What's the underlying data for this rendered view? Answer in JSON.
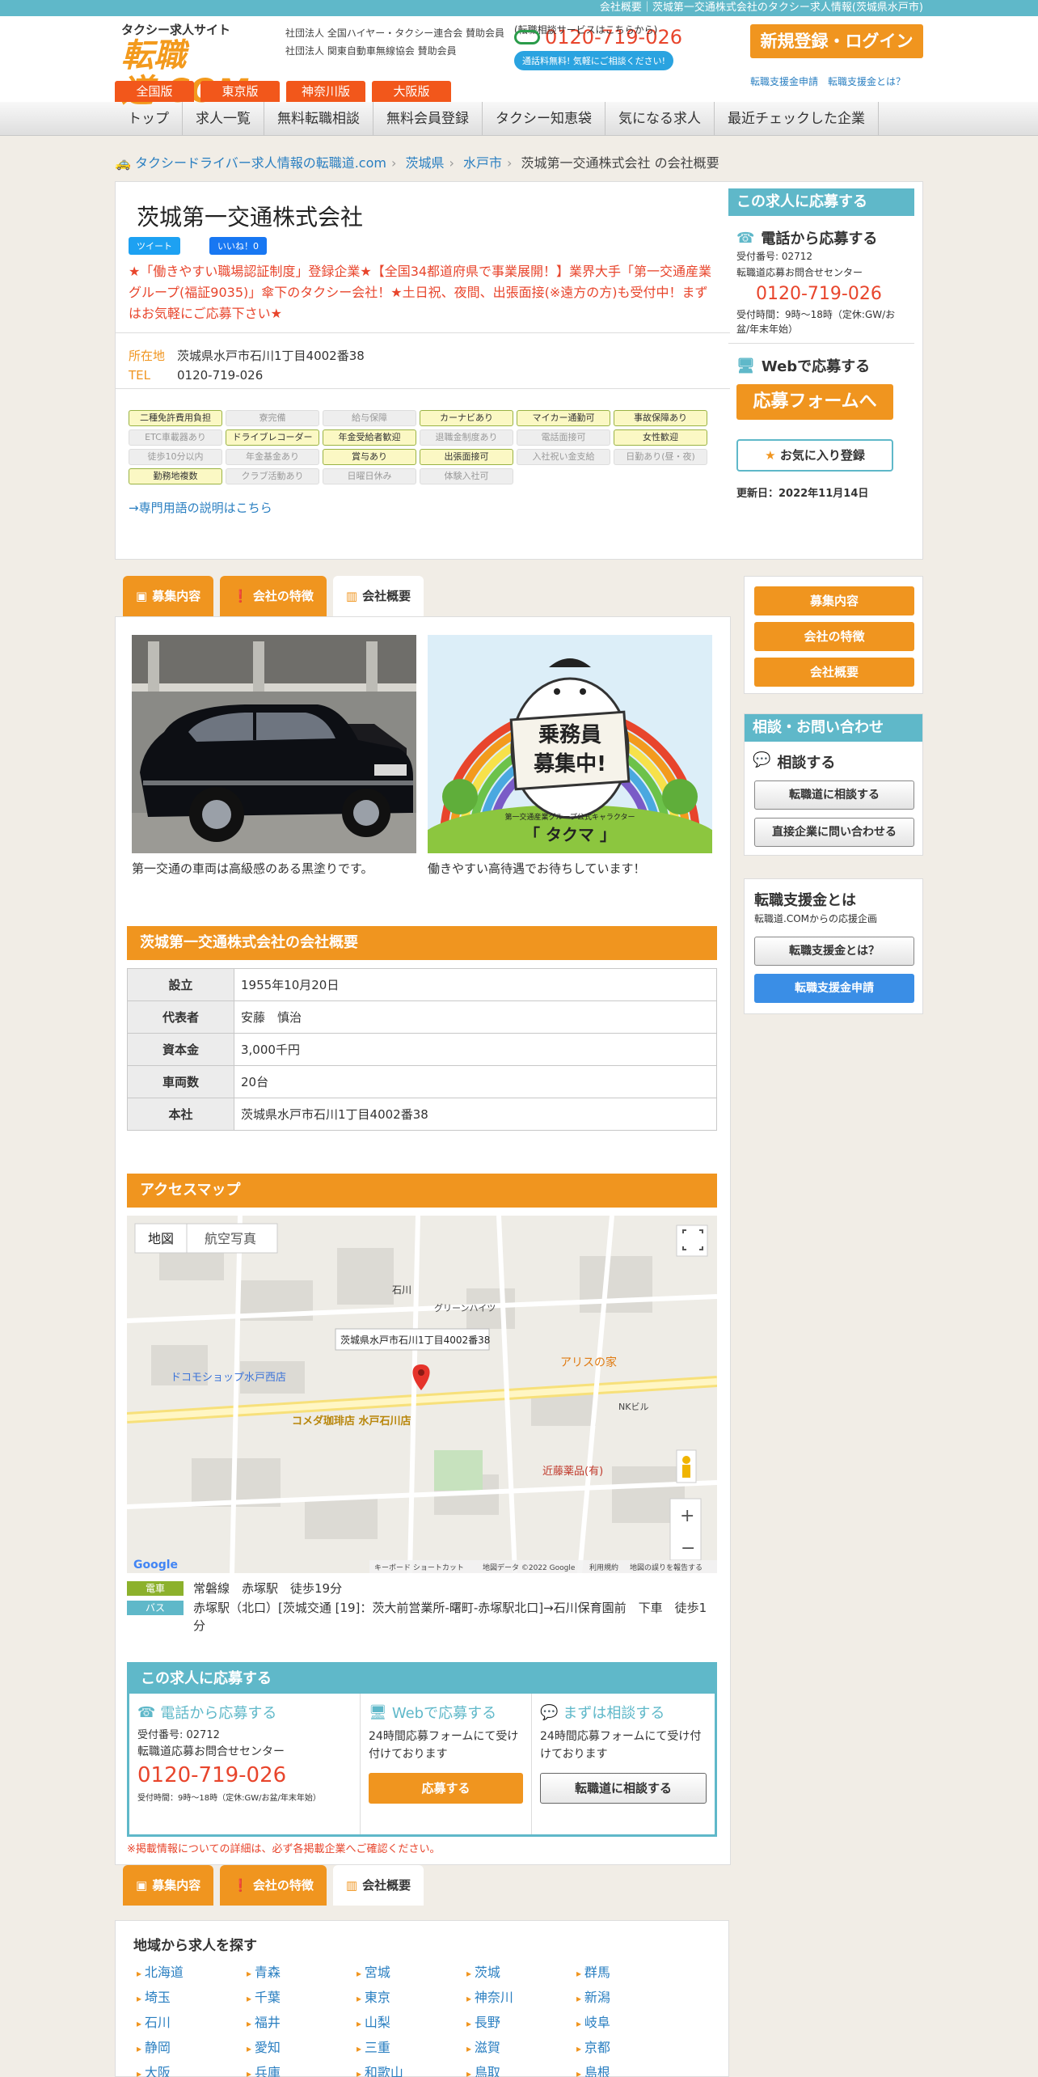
{
  "topbar": "会社概要｜茨城第一交通株式会社のタクシー求人情報(茨城県水戸市)",
  "logo": {
    "line1": "タクシー求人サイト",
    "line2": "転職道.COM"
  },
  "assoc": [
    "社団法人 全国ハイヤー・タクシー連合会 賛助会員",
    "社団法人 関東自動車無線協会 賛助会員"
  ],
  "hdr_tel": {
    "caption": "(転職相談サービスはこちらから)",
    "number": "0120-719-026",
    "pill": "通話料無料! 気軽にご相談ください!"
  },
  "register_button": "新規登録・ログイン",
  "reg_links": [
    "転職支援金申請",
    "転職支援金とは？"
  ],
  "region_tabs": [
    "全国版",
    "東京版",
    "神奈川版",
    "大阪版"
  ],
  "nav": [
    "トップ",
    "求人一覧",
    "無料転職相談",
    "無料会員登録",
    "タクシー知恵袋",
    "気になる求人",
    "最近チェックした企業"
  ],
  "breadcrumb": [
    "タクシードライバー求人情報の転職道.com",
    "茨城県",
    "水戸市",
    "茨城第一交通株式会社 の会社概要"
  ],
  "company": {
    "name": "茨城第一交通株式会社",
    "tweet": "ツイート",
    "like": "いいね！0",
    "catch": "★「働きやすい職場認証制度」登録企業★【全国34都道府県で事業展開！】業界大手「第一交通産業グループ(福証9035)」傘下のタクシー会社！★土日祝、夜間、出張面接(※遠方の方)も受付中！まずはお気軽にご応募下さい★",
    "address_label": "所在地",
    "address": "茨城県水戸市石川1丁目4002番38",
    "tel_label": "TEL",
    "tel": "0120-719-026"
  },
  "tags": [
    {
      "t": "二種免許費用負担",
      "on": true
    },
    {
      "t": "寮完備",
      "on": false
    },
    {
      "t": "給与保障",
      "on": false
    },
    {
      "t": "カーナビあり",
      "on": true
    },
    {
      "t": "マイカー通勤可",
      "on": true
    },
    {
      "t": "事故保障あり",
      "on": true
    },
    {
      "t": "ETC車載器あり",
      "on": false
    },
    {
      "t": "ドライブレコーダー",
      "on": true
    },
    {
      "t": "年金受給者歓迎",
      "on": true
    },
    {
      "t": "退職金制度あり",
      "on": false
    },
    {
      "t": "電話面接可",
      "on": false
    },
    {
      "t": "女性歓迎",
      "on": true
    },
    {
      "t": "徒歩10分以内",
      "on": false
    },
    {
      "t": "年金基金あり",
      "on": false
    },
    {
      "t": "賞与あり",
      "on": true
    },
    {
      "t": "出張面接可",
      "on": true
    },
    {
      "t": "入社祝い金支給",
      "on": false
    },
    {
      "t": "日勤あり(昼・夜)",
      "on": false
    },
    {
      "t": "勤務地複数",
      "on": true
    },
    {
      "t": "クラブ活動あり",
      "on": false
    },
    {
      "t": "日曜日休み",
      "on": false
    },
    {
      "t": "体験入社可",
      "on": false
    }
  ],
  "glossary": "→専門用語の説明はこちら",
  "side": {
    "header": "この求人に応募する",
    "phone_title": "電話から応募する",
    "recept": "受付番号: 02712",
    "center": "転職道応募お問合せセンター",
    "tel": "0120-719-026",
    "hours": "受付時間：9時～18時（定休:GW/お盆/年末年始）",
    "web_title": "Webで応募する",
    "form_btn": "応募フォームへ",
    "fav_btn": "お気に入り登録",
    "updated": "更新日：2022年11月14日"
  },
  "content_tabs": [
    "募集内容",
    "会社の特徴",
    "会社概要"
  ],
  "photos": [
    {
      "caption": "第一交通の車両は高級感のある黒塗りです。"
    },
    {
      "caption": "働きやすい高待遇でお待ちしています！",
      "sign1": "乗務員",
      "sign2": "募集中!",
      "brand": "第一交通産業グループ公式キャラクター",
      "char": "「 タクマ 」"
    }
  ],
  "overview": {
    "title": "茨城第一交通株式会社の会社概要",
    "rows": [
      [
        "設立",
        "1955年10月20日"
      ],
      [
        "代表者",
        "安藤　慎治"
      ],
      [
        "資本金",
        "3,000千円"
      ],
      [
        "車両数",
        "20台"
      ],
      [
        "本社",
        "茨城県水戸市石川1丁目4002番38"
      ]
    ]
  },
  "access": {
    "title": "アクセスマップ",
    "map_tabs": [
      "地図",
      "航空写真"
    ],
    "map_popup": "茨城県水戸市石川1丁目4002番38",
    "map_labels": [
      "石川",
      "アリスの家",
      "コメダ珈琲店 水戸石川店",
      "ドコモショップ水戸西店",
      "近藤薬品(有)",
      "グリーンハイツ",
      "NKビル",
      "Google",
      "キーボード ショートカット",
      "地図データ ©2022 Google",
      "利用規約",
      "地図の誤りを報告する"
    ],
    "train_label": "電車",
    "train": "常磐線　赤塚駅　徒歩19分",
    "bus_label": "バス",
    "bus": "赤塚駅（北口）[茨城交通 [19]：茨大前営業所-曙町-赤塚駅北口]→石川保育園前　下車　徒歩1分"
  },
  "apply_box": {
    "header": "この求人に応募する",
    "phone_title": "電話から応募する",
    "recept": "受付番号: 02712",
    "center": "転職道応募お問合せセンター",
    "tel": "0120-719-026",
    "hours": "受付時間：9時～18時（定休:GW/お盆/年末年始）",
    "web_title": "Webで応募する",
    "web_text": "24時間応募フォームにて受け付けております",
    "web_btn": "応募する",
    "consult_title": "まずは相談する",
    "consult_text": "24時間応募フォームにて受け付けております",
    "consult_btn": "転職道に相談する"
  },
  "note": "※掲載情報についての詳細は、必ず各掲載企業へご確認ください。",
  "right": {
    "nav": [
      "募集内容",
      "会社の特徴",
      "会社概要"
    ],
    "contact_header": "相談・お問い合わせ",
    "consult_title": "相談する",
    "consult_btn": "転職道に相談する",
    "direct_btn": "直接企業に問い合わせる",
    "support_title": "転職支援金とは",
    "support_sub": "転職道.COMからの応援企画",
    "support_btn": "転職支援金とは？",
    "support_apply": "転職支援金申請"
  },
  "area": {
    "title": "地域から求人を探す",
    "prefs": [
      "北海道",
      "青森",
      "宮城",
      "茨城",
      "群馬",
      "埼玉",
      "千葉",
      "東京",
      "神奈川",
      "新潟",
      "石川",
      "福井",
      "山梨",
      "長野",
      "岐阜",
      "静岡",
      "愛知",
      "三重",
      "滋賀",
      "京都",
      "大阪",
      "兵庫",
      "和歌山",
      "鳥取",
      "島根"
    ]
  }
}
